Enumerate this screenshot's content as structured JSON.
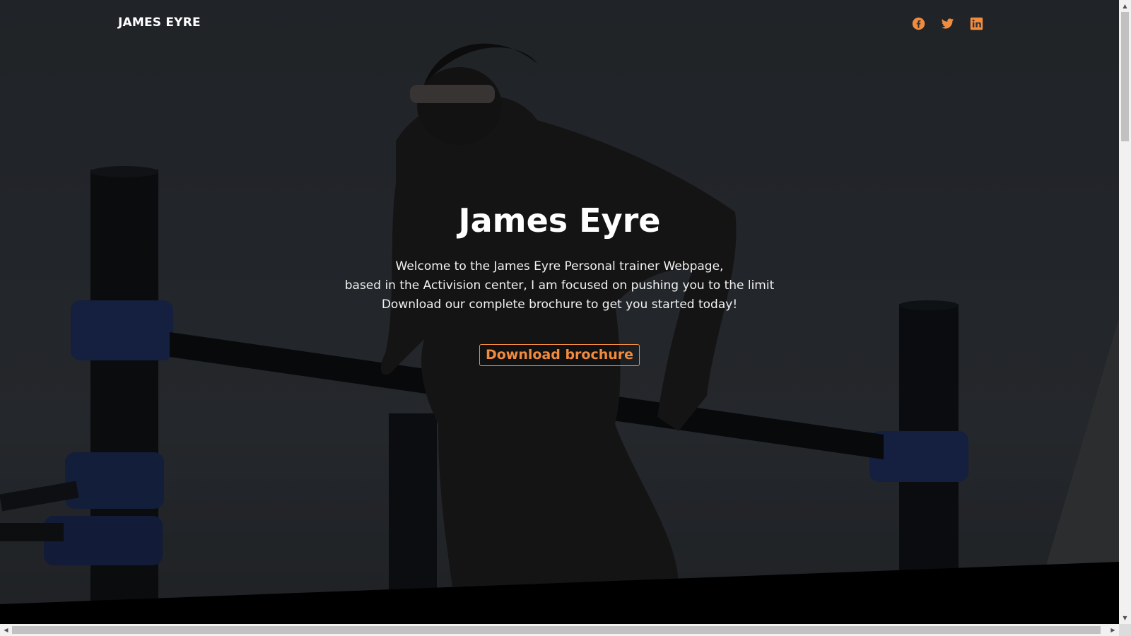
{
  "navbar": {
    "brand": "JAMES EYRE",
    "social": [
      {
        "icon": "facebook-icon"
      },
      {
        "icon": "twitter-icon"
      },
      {
        "icon": "linkedin-icon"
      }
    ]
  },
  "hero": {
    "title": "James Eyre",
    "lines": [
      "Welcome to the James Eyre Personal trainer Webpage,",
      "based in the Activision center, I am focused on pushing you to the limit",
      "Download our complete brochure to get you started today!"
    ],
    "button_label": "Download brochure"
  },
  "colors": {
    "accent": "#f38b3c",
    "text": "#ffffff",
    "overlay": "#2e3238"
  }
}
